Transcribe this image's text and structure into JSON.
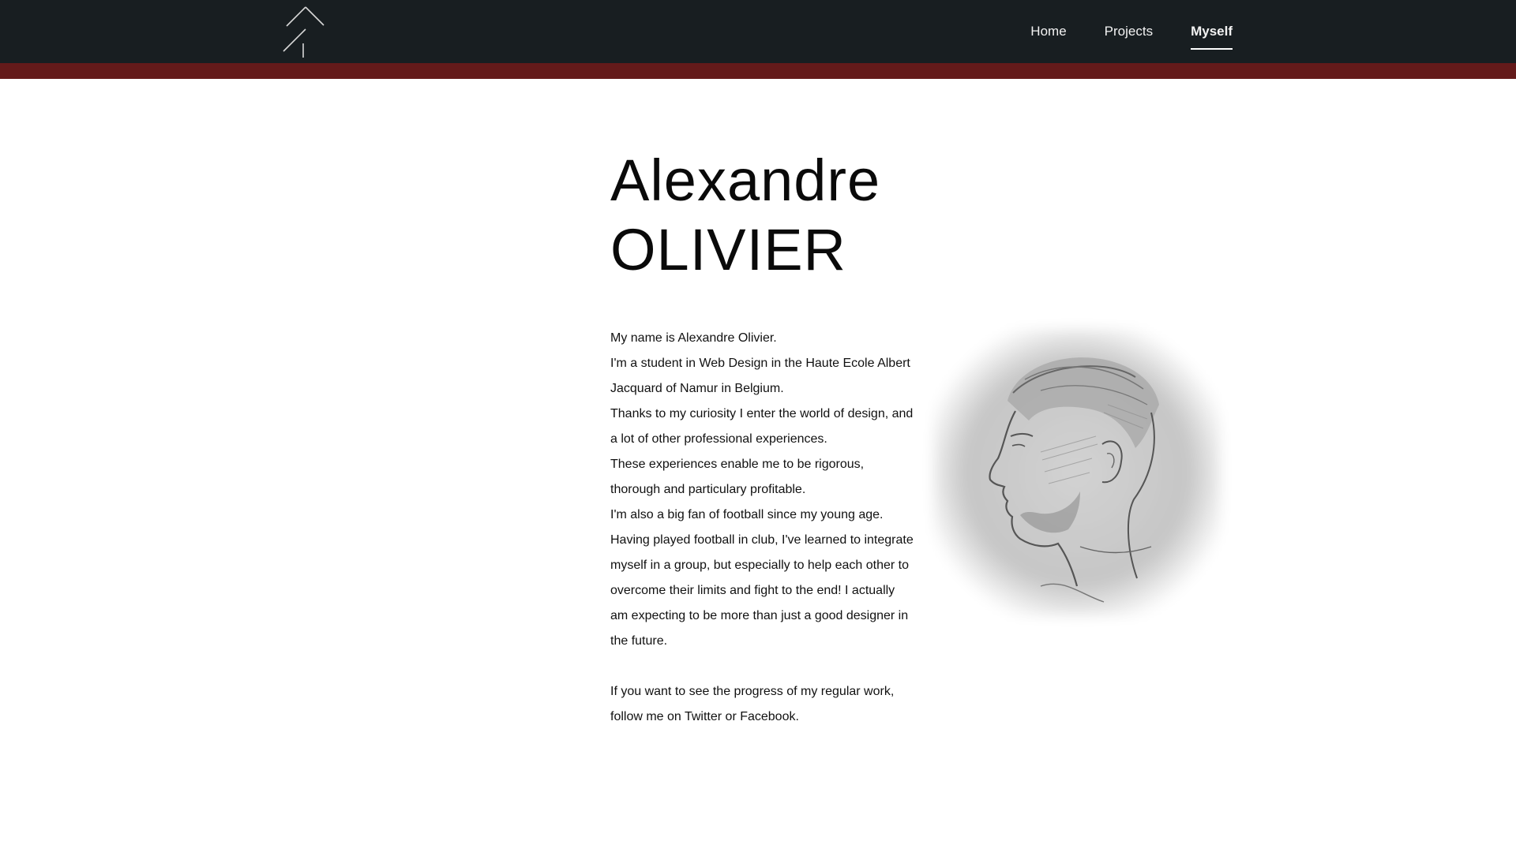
{
  "nav": {
    "home": "Home",
    "projects": "Projects",
    "myself": "Myself"
  },
  "profile": {
    "first_name": "Alexandre",
    "last_name": "OLIVIER"
  },
  "bio": {
    "lines": [
      "My name is Alexandre Olivier.",
      "I'm a student in Web Design in the Haute Ecole Albert Jacquard of Namur in Belgium.",
      "Thanks to my curiosity I enter the world of design, and a lot of other professional experiences.",
      "These experiences enable me to be rigorous, thorough and particulary profitable.",
      "I'm also a big fan of football since my young age. Having played football in club, I've learned to integrate myself in a group, but especially to help each other to overcome their limits and fight to the end! I actually am expecting to be more than just a good designer in the future."
    ],
    "follow": "If you want to see the progress of my regular work, follow me on Twitter or Facebook."
  },
  "colors": {
    "topbar": "#181e21",
    "accent": "#641a1a",
    "background": "#ffffff"
  },
  "icons": {
    "logo": "arrow-tree-logo-icon"
  }
}
